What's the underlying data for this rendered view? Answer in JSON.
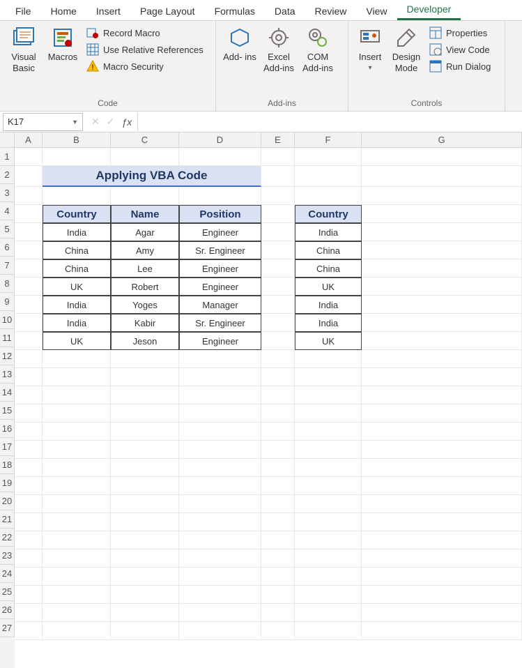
{
  "tabs": [
    "File",
    "Home",
    "Insert",
    "Page Layout",
    "Formulas",
    "Data",
    "Review",
    "View",
    "Developer"
  ],
  "active_tab": "Developer",
  "ribbon": {
    "code": {
      "label": "Code",
      "visual_basic": "Visual\nBasic",
      "macros": "Macros",
      "record_macro": "Record Macro",
      "use_rel_ref": "Use Relative References",
      "macro_security": "Macro Security"
    },
    "addins": {
      "label": "Add-ins",
      "addins": "Add-\nins",
      "excel_addins": "Excel\nAdd-ins",
      "com_addins": "COM\nAdd-ins"
    },
    "controls": {
      "label": "Controls",
      "insert": "Insert",
      "design_mode": "Design\nMode",
      "properties": "Properties",
      "view_code": "View Code",
      "run_dialog": "Run Dialog"
    }
  },
  "name_box": "K17",
  "formula": "",
  "columns": [
    "A",
    "B",
    "C",
    "D",
    "E",
    "F",
    "G"
  ],
  "row_count": 27,
  "title": "Applying VBA Code",
  "table1": {
    "headers": [
      "Country",
      "Name",
      "Position"
    ],
    "rows": [
      [
        "India",
        "Agar",
        "Engineer"
      ],
      [
        "China",
        "Amy",
        "Sr. Engineer"
      ],
      [
        "China",
        "Lee",
        "Engineer"
      ],
      [
        "UK",
        "Robert",
        "Engineer"
      ],
      [
        "India",
        "Yoges",
        "Manager"
      ],
      [
        "India",
        "Kabir",
        "Sr. Engineer"
      ],
      [
        "UK",
        "Jeson",
        "Engineer"
      ]
    ]
  },
  "table2": {
    "header": "Country",
    "rows": [
      "India",
      "China",
      "China",
      "UK",
      "India",
      "India",
      "UK"
    ]
  }
}
